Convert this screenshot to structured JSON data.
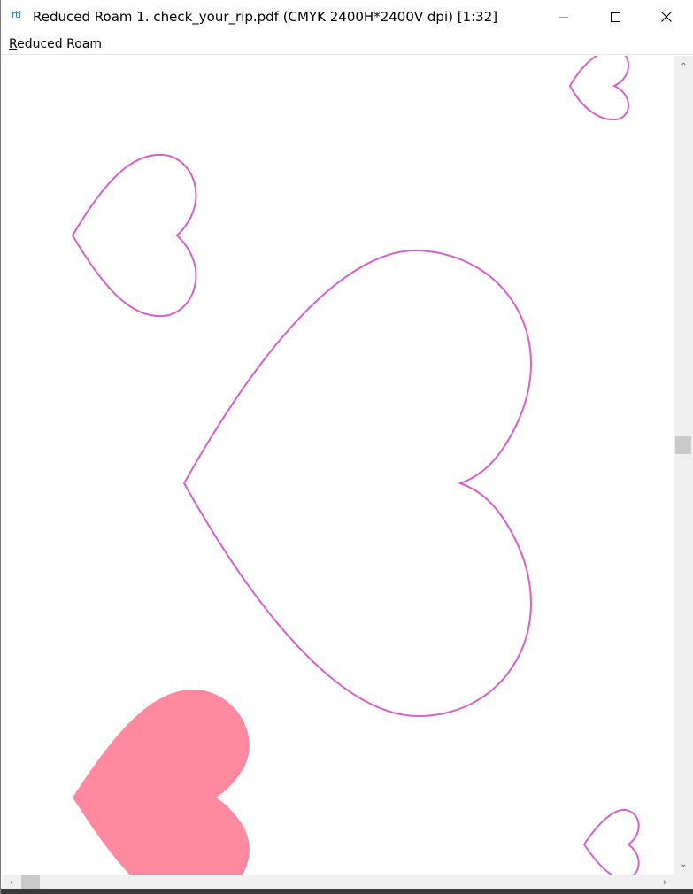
{
  "window": {
    "app_icon_text": "rti",
    "title": "Reduced Roam 1. check_your_rip.pdf  (CMYK 2400H*2400V dpi)  [1:32]",
    "close_glyph": "✕"
  },
  "menu": {
    "items": [
      {
        "accelerator": "R",
        "rest": "educed Roam"
      }
    ]
  },
  "scrollbars": {
    "up_glyph": "⌃",
    "down_glyph": "⌄",
    "left_glyph": "‹",
    "right_glyph": "›"
  },
  "canvas": {
    "background": "#ffffff",
    "outline_color": "#d95fc8",
    "fill_color": "#ff8aa0"
  },
  "icons": [
    "app-icon",
    "minimize-icon",
    "maximize-icon",
    "close-icon",
    "scroll-up-icon",
    "scroll-down-icon",
    "scroll-left-icon",
    "scroll-right-icon"
  ]
}
